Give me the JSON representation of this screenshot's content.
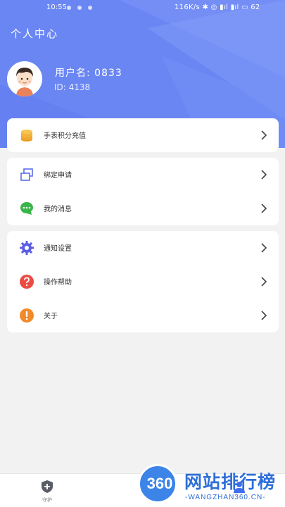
{
  "status_bar": {
    "time": "10:55",
    "right_text": "116K/s ✱ ◎ ▮ıl ▮ıl ▭ 62"
  },
  "header": {
    "title": "个人中心",
    "username": "用户名: 0833",
    "user_id": "ID: 4138",
    "gradient_color": "#6b87f4"
  },
  "menu": {
    "group1": [
      {
        "label": "手表积分充值",
        "icon": "coin-stack-icon"
      }
    ],
    "group2": [
      {
        "label": "绑定申请",
        "icon": "bind-squares-icon"
      },
      {
        "label": "我的消息",
        "icon": "chat-bubble-icon"
      }
    ],
    "group3": [
      {
        "label": "通知设置",
        "icon": "gear-icon"
      },
      {
        "label": "操作帮助",
        "icon": "question-icon"
      },
      {
        "label": "关于",
        "icon": "exclamation-icon"
      }
    ]
  },
  "tabbar": {
    "tabs": [
      {
        "label": "守护",
        "icon": "shield-plus-icon"
      }
    ]
  },
  "watermark": {
    "badge": "360",
    "title": "网站排行榜",
    "subtitle": "-WANGZHAN360.CN-"
  },
  "colors": {
    "coin": "#f3b23a",
    "bind": "#5b6ee8",
    "chat": "#3ab54a",
    "gear": "#5b5fe0",
    "question": "#ec4b44",
    "exclamation": "#f08a2b"
  }
}
